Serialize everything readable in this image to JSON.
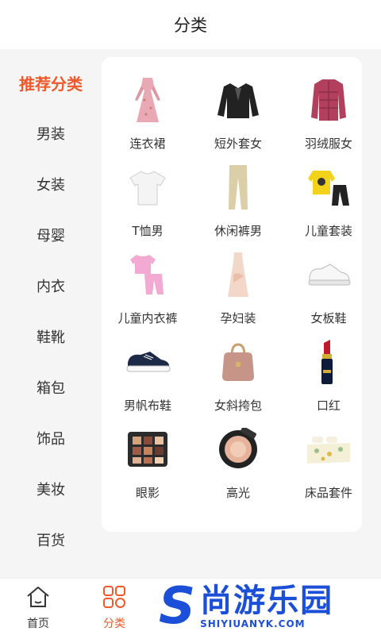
{
  "header": {
    "title": "分类"
  },
  "sidebar": {
    "items": [
      {
        "label": "推荐分类",
        "active": true
      },
      {
        "label": "男装"
      },
      {
        "label": "女装"
      },
      {
        "label": "母婴"
      },
      {
        "label": "内衣"
      },
      {
        "label": "鞋靴"
      },
      {
        "label": "箱包"
      },
      {
        "label": "饰品"
      },
      {
        "label": "美妆"
      },
      {
        "label": "百货"
      }
    ]
  },
  "grid": {
    "items": [
      {
        "label": "连衣裙",
        "icon": "dress-icon"
      },
      {
        "label": "短外套女",
        "icon": "cardigan-icon"
      },
      {
        "label": "羽绒服女",
        "icon": "down-jacket-icon"
      },
      {
        "label": "T恤男",
        "icon": "tshirt-icon"
      },
      {
        "label": "休闲裤男",
        "icon": "trousers-icon"
      },
      {
        "label": "儿童套装",
        "icon": "kids-set-icon"
      },
      {
        "label": "儿童内衣裤",
        "icon": "kids-underwear-icon"
      },
      {
        "label": "孕妇装",
        "icon": "maternity-dress-icon"
      },
      {
        "label": "女板鞋",
        "icon": "sneaker-icon"
      },
      {
        "label": "男帆布鞋",
        "icon": "canvas-shoe-icon"
      },
      {
        "label": "女斜挎包",
        "icon": "handbag-icon"
      },
      {
        "label": "口红",
        "icon": "lipstick-icon"
      },
      {
        "label": "眼影",
        "icon": "eyeshadow-palette-icon"
      },
      {
        "label": "高光",
        "icon": "highlighter-icon"
      },
      {
        "label": "床品套件",
        "icon": "bedding-icon"
      }
    ]
  },
  "tabs": {
    "home": "首页",
    "category": "分类"
  },
  "watermark": {
    "letter": "S",
    "cn": "尚游乐园",
    "en": "SHIYIUANYK.COM"
  },
  "colors": {
    "accent": "#ee5a2a",
    "watermark": "#1b4fd8"
  }
}
